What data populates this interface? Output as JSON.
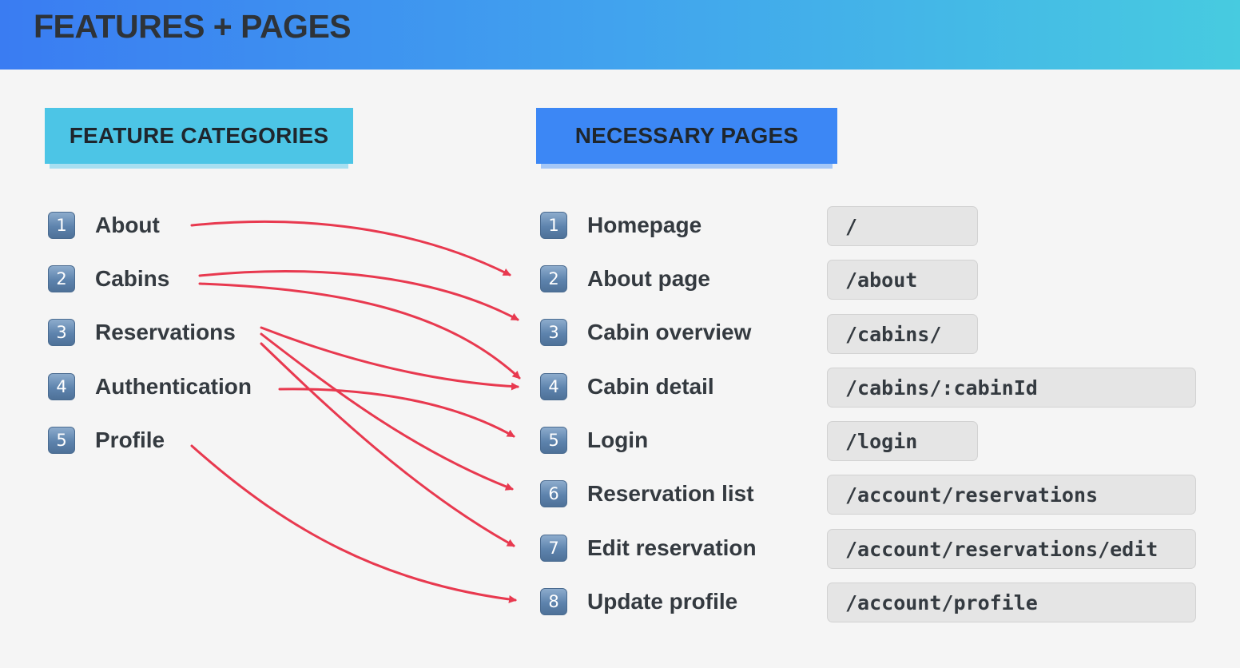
{
  "header": {
    "title": "FEATURES + PAGES"
  },
  "features": {
    "heading": "FEATURE CATEGORIES",
    "items": [
      {
        "num": "1",
        "label": "About"
      },
      {
        "num": "2",
        "label": "Cabins"
      },
      {
        "num": "3",
        "label": "Reservations"
      },
      {
        "num": "4",
        "label": "Authentication"
      },
      {
        "num": "5",
        "label": "Profile"
      }
    ]
  },
  "pages": {
    "heading": "NECESSARY PAGES",
    "items": [
      {
        "num": "1",
        "label": "Homepage",
        "route": "/"
      },
      {
        "num": "2",
        "label": "About page",
        "route": "/about"
      },
      {
        "num": "3",
        "label": "Cabin overview",
        "route": "/cabins/"
      },
      {
        "num": "4",
        "label": "Cabin detail",
        "route": "/cabins/:cabinId"
      },
      {
        "num": "5",
        "label": "Login",
        "route": "/login"
      },
      {
        "num": "6",
        "label": "Reservation list",
        "route": "/account/reservations"
      },
      {
        "num": "7",
        "label": "Edit reservation",
        "route": "/account/reservations/edit"
      },
      {
        "num": "8",
        "label": "Update profile",
        "route": "/account/profile"
      }
    ]
  },
  "arrow_color": "#e8394f",
  "badge_color": "#5d83ad",
  "tag_colors": {
    "features": "#4cc5e6",
    "pages": "#3c87f5"
  }
}
